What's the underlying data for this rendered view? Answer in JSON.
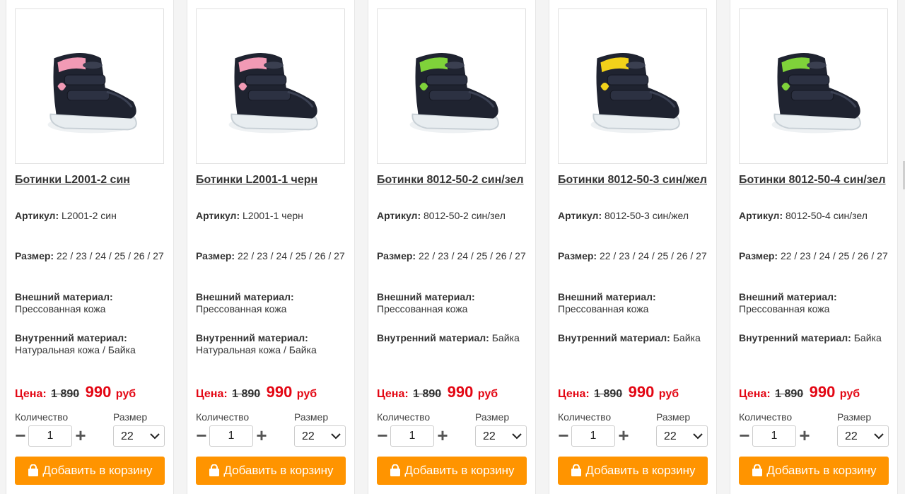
{
  "labels": {
    "sku": "Артикул:",
    "size": "Размер:",
    "outer": "Внешний материал:",
    "inner": "Внутренний материал:",
    "price": "Цена:",
    "currency": "руб",
    "quantity": "Количество",
    "size_select": "Размер",
    "add_to_cart": "Добавить в корзину"
  },
  "accent_colors": {
    "button": "#ff9400",
    "price": "#e30613"
  },
  "products": [
    {
      "title": "Ботинки L2001-2 син",
      "sku": "L2001-2 син",
      "sizes": "22 / 23 / 24 / 25 / 26 / 27",
      "outer": "Прессованная кожа",
      "inner": "Натуральная кожа / Байка",
      "old_price": "1 890",
      "price": "990",
      "quantity": "1",
      "selected_size": "22",
      "image_icon": "boot-photo-pink-heart"
    },
    {
      "title": "Ботинки L2001-1 черн",
      "sku": "L2001-1 черн",
      "sizes": "22 / 23 / 24 / 25 / 26 / 27",
      "outer": "Прессованная кожа",
      "inner": "Натуральная кожа / Байка",
      "old_price": "1 890",
      "price": "990",
      "quantity": "1",
      "selected_size": "22",
      "image_icon": "boot-photo-pink-heart"
    },
    {
      "title": "Ботинки 8012-50-2 син/зел",
      "sku": "8012-50-2 син/зел",
      "sizes": "22 / 23 / 24 / 25 / 26 / 27",
      "outer": "Прессованная кожа",
      "inner": "Байка",
      "old_price": "1 890",
      "price": "990",
      "quantity": "1",
      "selected_size": "22",
      "image_icon": "boot-photo-green"
    },
    {
      "title": "Ботинки 8012-50-3 син/жел",
      "sku": "8012-50-3 син/жел",
      "sizes": "22 / 23 / 24 / 25 / 26 / 27",
      "outer": "Прессованная кожа",
      "inner": "Байка",
      "old_price": "1 890",
      "price": "990",
      "quantity": "1",
      "selected_size": "22",
      "image_icon": "boot-photo-yellow"
    },
    {
      "title": "Ботинки 8012-50-4 син/зел",
      "sku": "8012-50-4 син/зел",
      "sizes": "22 / 23 / 24 / 25 / 26 / 27",
      "outer": "Прессованная кожа",
      "inner": "Байка",
      "old_price": "1 890",
      "price": "990",
      "quantity": "1",
      "selected_size": "22",
      "image_icon": "boot-photo-green"
    }
  ]
}
